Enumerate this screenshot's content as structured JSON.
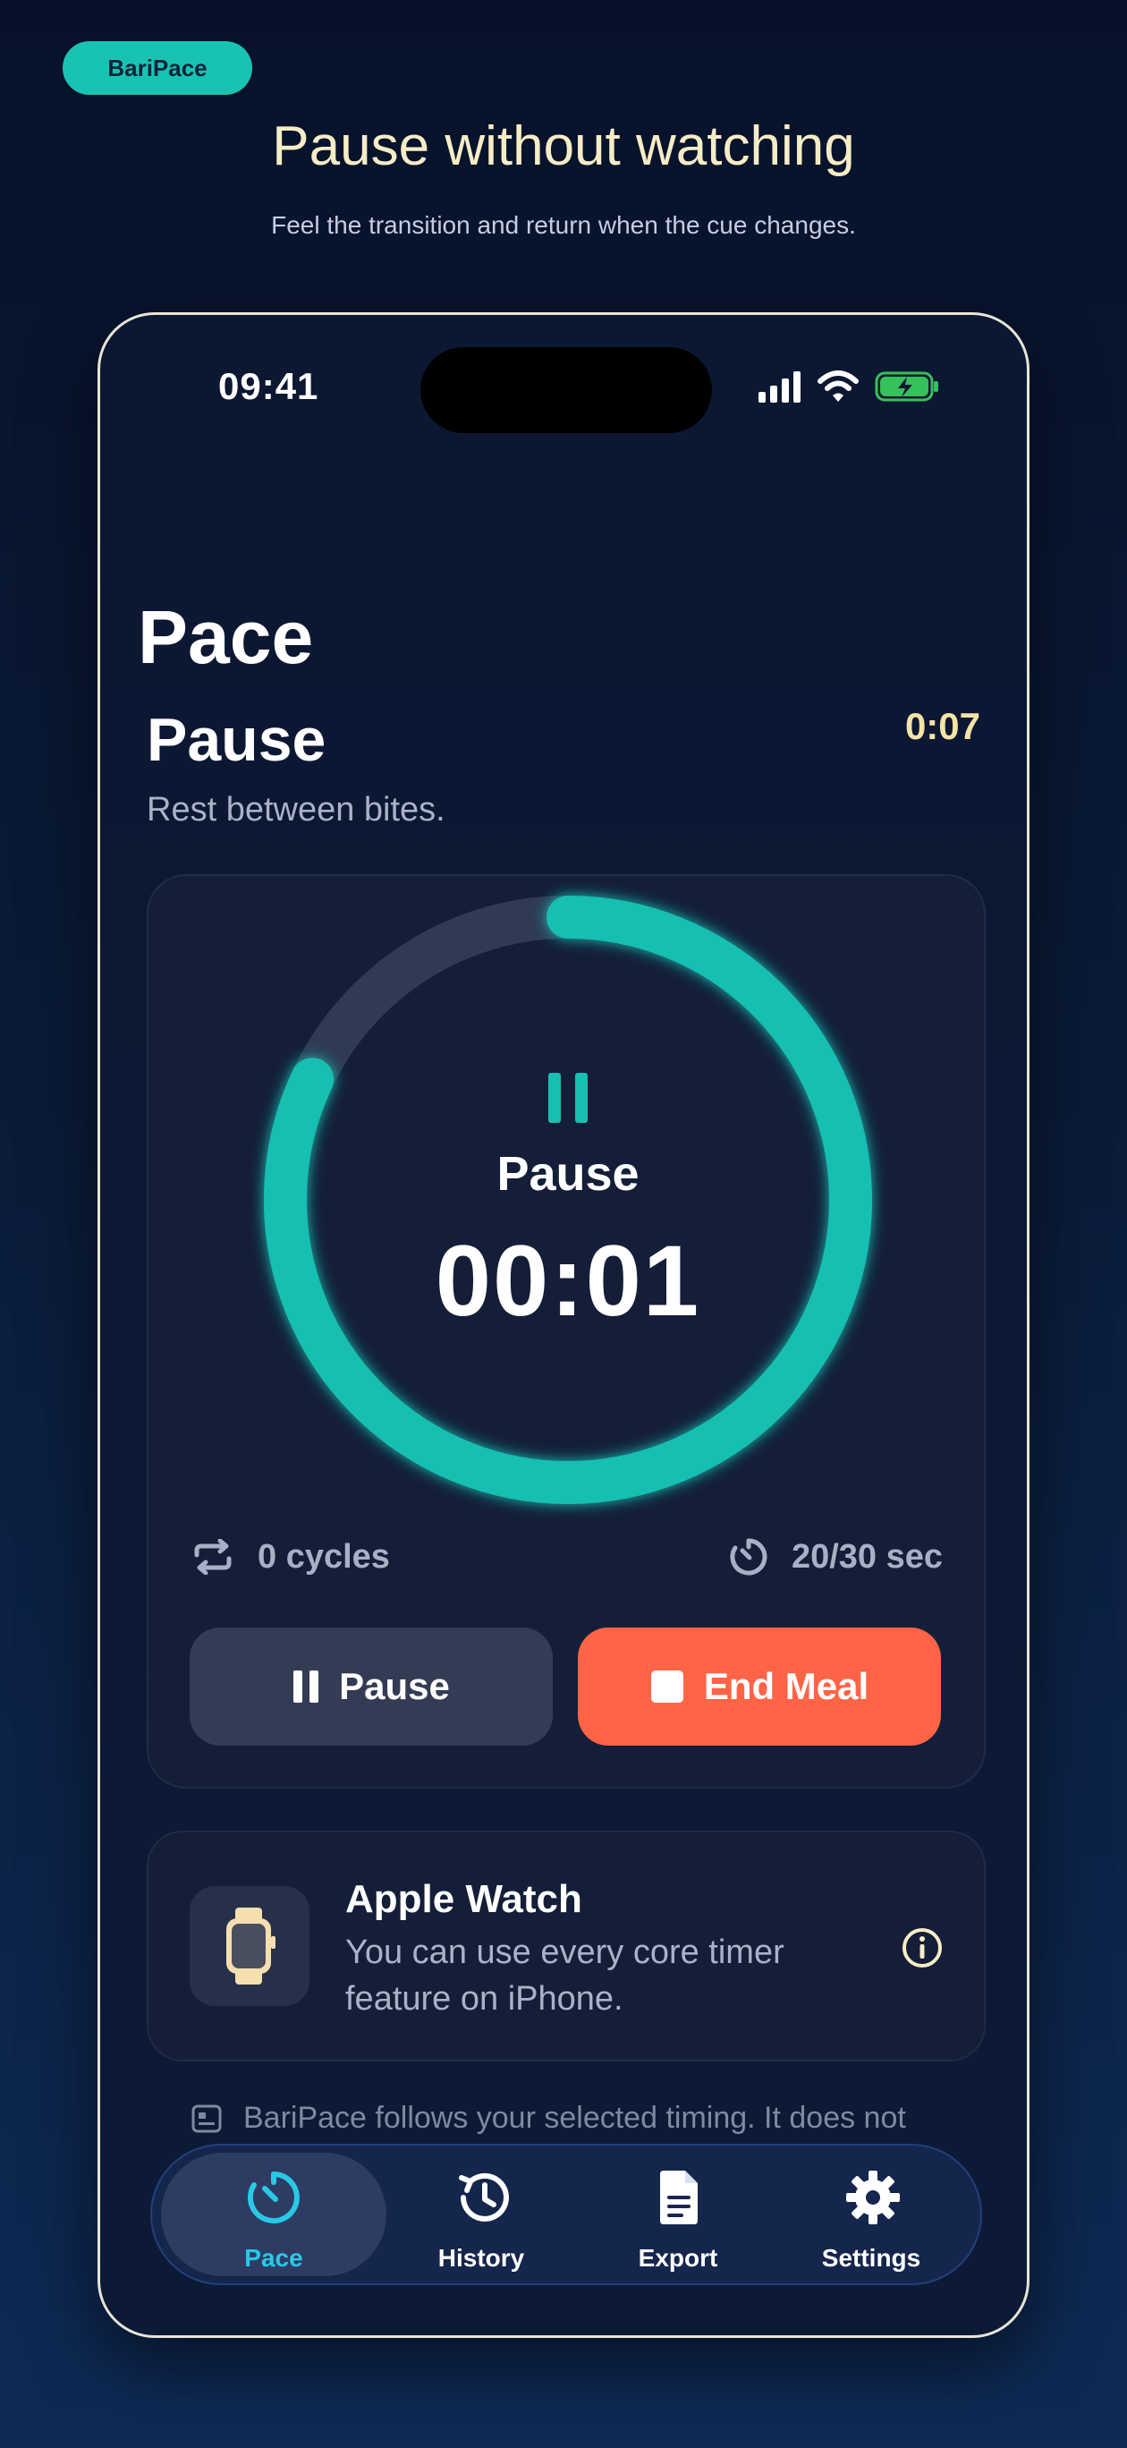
{
  "brand": {
    "label": "BariPace"
  },
  "hero": {
    "headline": "Pause without watching",
    "subline": "Feel the transition and return when the cue changes."
  },
  "status_bar": {
    "time": "09:41"
  },
  "screen": {
    "title": "Pace",
    "phase_title": "Pause",
    "phase_subtitle": "Rest between bites.",
    "elapsed": "0:07"
  },
  "timer": {
    "phase_label": "Pause",
    "countdown": "00:01",
    "ring_progress": 0.82,
    "ring_color": "#19bfb1",
    "track_color": "#303a54"
  },
  "stats": {
    "cycles": "0 cycles",
    "duration": "20/30 sec"
  },
  "buttons": {
    "pause_label": "Pause",
    "end_label": "End Meal"
  },
  "watch_card": {
    "title": "Apple Watch",
    "description": "You can use every core timer feature on iPhone."
  },
  "disclaimer": "BariPace follows your selected timing. It does not",
  "tabs": [
    {
      "label": "Pace",
      "icon": "timer-icon",
      "active": true
    },
    {
      "label": "History",
      "icon": "history-icon",
      "active": false
    },
    {
      "label": "Export",
      "icon": "document-icon",
      "active": false
    },
    {
      "label": "Settings",
      "icon": "gear-icon",
      "active": false
    }
  ],
  "colors": {
    "accent_teal": "#19c3b4",
    "end_button": "#ff6446",
    "headline_cream": "#f6ecc6",
    "active_tab": "#28c9e6"
  }
}
